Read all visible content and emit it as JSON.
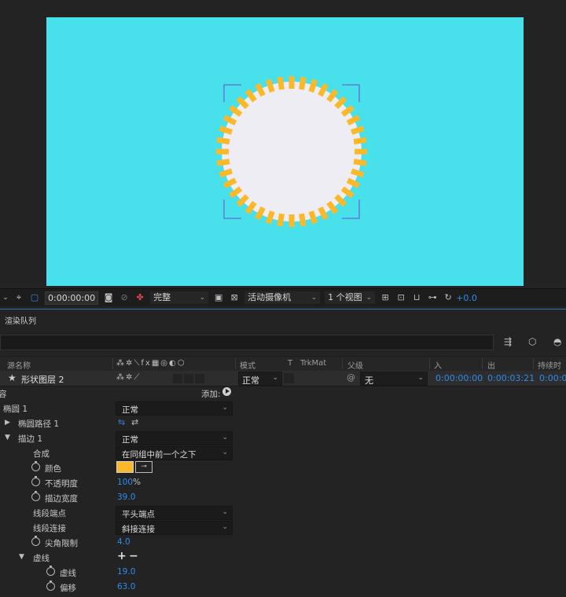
{
  "viewer": {
    "canvas_bg": "#47e0eb",
    "sun_fill": "#efedf4",
    "dash_color": "#fbb829"
  },
  "toolbar": {
    "time": "0:00:00:00",
    "quality": "完整",
    "camera": "活动摄像机",
    "views": "1 个视图",
    "exposure": "+0.0"
  },
  "render_queue": {
    "title": "渲染队列"
  },
  "columns": {
    "source_name": "源名称",
    "mode": "模式",
    "t": "T",
    "trkmat": "TrkMat",
    "parent": "父级",
    "in": "入",
    "out": "出",
    "duration": "持续时"
  },
  "layer": {
    "name": "形状图层 2",
    "mode": "正常",
    "parent": "无",
    "in": "0:00:00:00",
    "out": "0:00:03:21",
    "duration": "0:00:0"
  },
  "properties": {
    "contents_label": "容",
    "add_label": "添加:",
    "ellipse": {
      "label": "椭圆 1",
      "blend": "正常"
    },
    "ellipse_path": {
      "label": "椭圆路径 1"
    },
    "stroke": {
      "label": "描边 1",
      "blend": "正常",
      "composite_label": "合成",
      "composite_value": "在同组中前一个之下",
      "color_label": "颜色",
      "color_value": "#fbb829",
      "opacity_label": "不透明度",
      "opacity_value": "100",
      "opacity_unit": "%",
      "width_label": "描边宽度",
      "width_value": "39.0",
      "cap_label": "线段端点",
      "cap_value": "平头端点",
      "join_label": "线段连接",
      "join_value": "斜接连接",
      "miter_label": "尖角限制",
      "miter_value": "4.0"
    },
    "dashes": {
      "label": "虚线",
      "dash_label": "虚线",
      "dash_value": "19.0",
      "offset_label": "偏移",
      "offset_value": "63.0"
    }
  }
}
